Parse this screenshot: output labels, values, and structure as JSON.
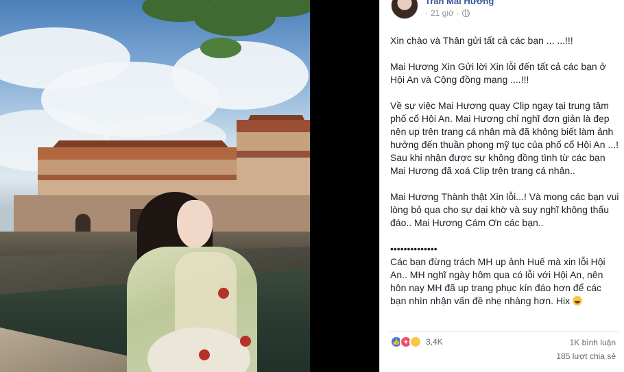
{
  "post": {
    "author": "Trần Mai Hương",
    "time": "21 giờ",
    "paragraphs": [
      "Xin chào và Thân gửi tất cả các bạn ... ...!!!",
      "Mai Hương Xin Gửi lời Xin lỗi đến tất cả các bạn ở Hội An và Cộng đồng mạng ....!!!",
      "Về sự việc Mai Hương quay Clip ngay tại trung tâm phố cổ Hội An. Mai Hương chỉ nghĩ đơn giản là đẹp nên up trên trang cá nhân mà đã không biết làm ảnh hưởng đến thuần phong mỹ tục của phố cổ Hội An ...!",
      "Sau khi nhận được sự không đồng tình từ các bạn Mai Hương đã xoá Clip trên trang cá nhân..",
      "Mai Hương Thành thật Xin lỗi...! Và mong các bạn vui lòng bỏ qua cho sự dại khờ và suy nghĩ không thấu đáo.. Mai Hương Cám Ơn các bạn..",
      "••••••••••••••",
      "Các bạn đừng trách MH up ảnh Huế mà xin lỗi Hội An.. MH nghĩ ngày hôm qua có lỗi với Hội An, nên hôn nay MH đã up trang phục kín đáo hơn để các bạn nhìn nhận vấn đề nhẹ nhàng hơn. Hix"
    ],
    "reaction_count": "3,4K",
    "comments": "1K bình luận",
    "shares": "185 lượt chia sẻ"
  },
  "icons": {
    "privacy": "globe-icon",
    "reactions": [
      "like-icon",
      "love-icon",
      "haha-icon"
    ],
    "emoji": "laughing-emoji-icon"
  },
  "colors": {
    "author_link": "#385898",
    "like": "#3b78e7",
    "love": "#f0506e",
    "haha": "#f7c948"
  }
}
